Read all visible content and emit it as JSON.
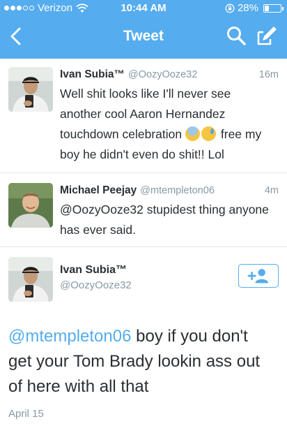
{
  "status_bar": {
    "carrier": "Verizon",
    "time": "10:44 AM",
    "battery": "28%",
    "battery_level": 0.28
  },
  "nav": {
    "title": "Tweet",
    "icons": [
      "back-chevron-icon",
      "search-icon",
      "compose-icon"
    ]
  },
  "tweets": [
    {
      "name": "Ivan Subia™",
      "handle": "@OozyOoze32",
      "age": "16m",
      "text_line1": "Well shit looks like I'll never see",
      "text_line2": "another cool Aaron Hernandez",
      "text_line3a": "touchdown celebration",
      "text_line3b": "free my",
      "text_line4": "boy he didn't even do shit!! Lol",
      "emojis": [
        "fearful-face-emoji",
        "cold-sweat-face-emoji"
      ]
    },
    {
      "name": "Michael Peejay",
      "handle": "@mtempleton06",
      "age": "4m",
      "text_line1": "@OozyOoze32 stupidest thing anyone",
      "text_line2": "has ever said."
    }
  ],
  "detail": {
    "name": "Ivan Subia™",
    "handle": "@OozyOoze32",
    "follow_icon": "follow-user-icon",
    "mention": "@mtempleton06",
    "text_part1": " boy if you don't",
    "text_line2": "get your Tom Brady lookin ass out",
    "text_line3": "of here with all that",
    "date": "April 15"
  },
  "colors": {
    "brand": "#55acee",
    "text": "#292f33",
    "muted": "#8899a6",
    "divider": "#e1e8ed"
  }
}
